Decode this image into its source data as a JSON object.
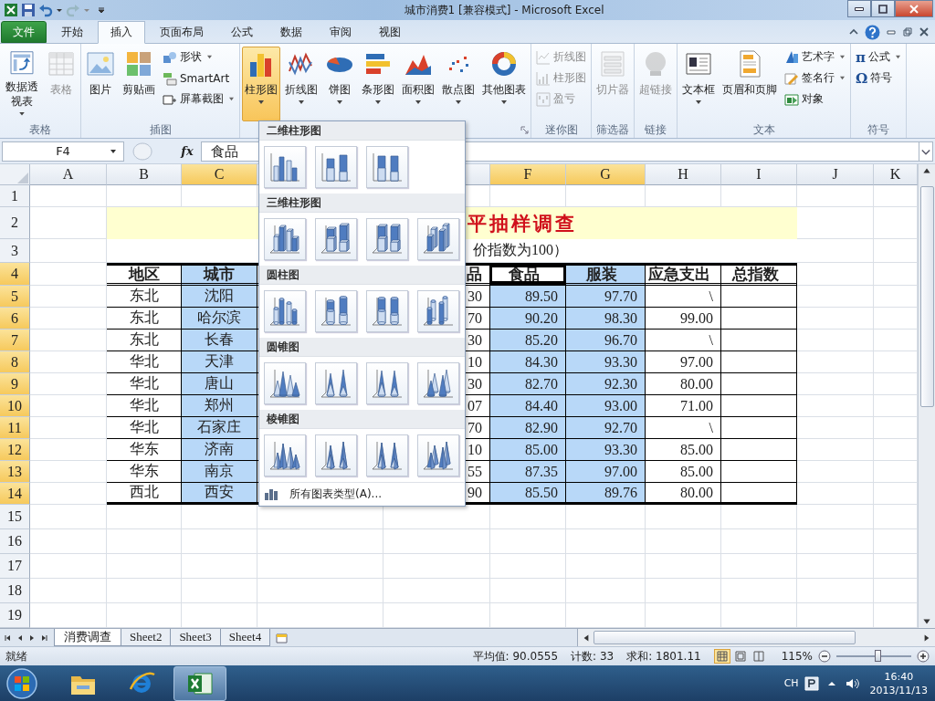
{
  "window": {
    "title": "城市消费1  [兼容模式] - Microsoft Excel"
  },
  "ribbon_tabs": [
    {
      "label": "文件",
      "kind": "file",
      "selected": false
    },
    {
      "label": "开始",
      "kind": "tab",
      "selected": false
    },
    {
      "label": "插入",
      "kind": "tab",
      "selected": true
    },
    {
      "label": "页面布局",
      "kind": "tab",
      "selected": false
    },
    {
      "label": "公式",
      "kind": "tab",
      "selected": false
    },
    {
      "label": "数据",
      "kind": "tab",
      "selected": false
    },
    {
      "label": "审阅",
      "kind": "tab",
      "selected": false
    },
    {
      "label": "视图",
      "kind": "tab",
      "selected": false
    }
  ],
  "ribbon_groups": [
    {
      "label": "表格",
      "launcher": false,
      "items": [
        {
          "kind": "large",
          "label": "数据透视表",
          "dropdown": true,
          "disabled": false,
          "pressed": false
        },
        {
          "kind": "large",
          "label": "表格",
          "dropdown": false,
          "disabled": true,
          "pressed": false
        }
      ]
    },
    {
      "label": "插图",
      "launcher": false,
      "items": [
        {
          "kind": "large",
          "label": "图片",
          "dropdown": false,
          "disabled": false,
          "pressed": false
        },
        {
          "kind": "large",
          "label": "剪贴画",
          "dropdown": false,
          "disabled": false,
          "pressed": false
        },
        {
          "kind": "small",
          "label": "形状",
          "dropdown": true,
          "disabled": false,
          "pressed": false
        },
        {
          "kind": "small",
          "label": "SmartArt",
          "dropdown": false,
          "disabled": false,
          "pressed": false
        },
        {
          "kind": "small",
          "label": "屏幕截图",
          "dropdown": true,
          "disabled": false,
          "pressed": false
        }
      ]
    },
    {
      "launcher": true,
      "items": [
        {
          "kind": "large",
          "label": "柱形图",
          "dropdown": true,
          "disabled": false,
          "pressed": true
        },
        {
          "kind": "large",
          "label": "折线图",
          "dropdown": true,
          "disabled": false,
          "pressed": false
        },
        {
          "kind": "large",
          "label": "饼图",
          "dropdown": true,
          "disabled": false,
          "pressed": false
        },
        {
          "kind": "large",
          "label": "条形图",
          "dropdown": true,
          "disabled": false,
          "pressed": false
        },
        {
          "kind": "large",
          "label": "面积图",
          "dropdown": true,
          "disabled": false,
          "pressed": false
        },
        {
          "kind": "large",
          "label": "散点图",
          "dropdown": true,
          "disabled": false,
          "pressed": false
        },
        {
          "kind": "large",
          "label": "其他图表",
          "dropdown": true,
          "disabled": false,
          "pressed": false
        }
      ]
    },
    {
      "label": "迷你图",
      "launcher": false,
      "items": [
        {
          "kind": "small",
          "label": "折线图",
          "dropdown": false,
          "disabled": true,
          "pressed": false
        },
        {
          "kind": "small",
          "label": "柱形图",
          "dropdown": false,
          "disabled": true,
          "pressed": false
        },
        {
          "kind": "small",
          "label": "盈亏",
          "dropdown": false,
          "disabled": true,
          "pressed": false
        }
      ]
    },
    {
      "label": "筛选器",
      "launcher": false,
      "items": [
        {
          "kind": "large",
          "label": "切片器",
          "dropdown": false,
          "disabled": true,
          "pressed": false
        }
      ]
    },
    {
      "label": "链接",
      "launcher": false,
      "items": [
        {
          "kind": "large",
          "label": "超链接",
          "dropdown": false,
          "disabled": true,
          "pressed": false
        }
      ]
    },
    {
      "label": "文本",
      "launcher": false,
      "items": [
        {
          "kind": "large",
          "label": "文本框",
          "dropdown": true,
          "disabled": false,
          "pressed": false
        },
        {
          "kind": "large",
          "label": "页眉和页脚",
          "dropdown": false,
          "disabled": false,
          "pressed": false
        },
        {
          "kind": "small",
          "label": "艺术字",
          "dropdown": true,
          "disabled": false,
          "pressed": false
        },
        {
          "kind": "small",
          "label": "签名行",
          "dropdown": true,
          "disabled": false,
          "pressed": false
        },
        {
          "kind": "small",
          "label": "对象",
          "dropdown": false,
          "disabled": false,
          "pressed": false
        }
      ]
    },
    {
      "label": "符号",
      "launcher": false,
      "items": [
        {
          "kind": "small",
          "glyph": "π",
          "label": "公式",
          "dropdown": true,
          "disabled": false,
          "pressed": false
        },
        {
          "kind": "small",
          "glyph": "Ω",
          "label": "符号",
          "dropdown": false,
          "disabled": false,
          "pressed": false
        }
      ]
    }
  ],
  "chart_menu": {
    "sections": [
      {
        "title": "二维柱形图",
        "kind": "column",
        "options": [
          {
            "selected": false
          },
          {
            "selected": false
          },
          {
            "selected": false
          }
        ]
      },
      {
        "title": "三维柱形图",
        "kind": "column3d",
        "options": [
          {
            "selected": false
          },
          {
            "selected": false
          },
          {
            "selected": false
          },
          {
            "selected": false
          }
        ]
      },
      {
        "title": "圆柱图",
        "kind": "cylinder",
        "options": [
          {
            "selected": false
          },
          {
            "selected": false
          },
          {
            "selected": false
          },
          {
            "selected": false
          }
        ]
      },
      {
        "title": "圆锥图",
        "kind": "cone",
        "options": [
          {
            "selected": false
          },
          {
            "selected": false
          },
          {
            "selected": false
          },
          {
            "selected": false
          }
        ]
      },
      {
        "title": "棱锥图",
        "kind": "pyramid",
        "options": [
          {
            "selected": false
          },
          {
            "selected": false
          },
          {
            "selected": false
          },
          {
            "selected": false
          }
        ]
      }
    ],
    "footer": "所有图表类型(A)..."
  },
  "formula_bar": {
    "name_box": "F4",
    "function_button": "fx",
    "formula": "食品"
  },
  "sheet": {
    "columns": [
      {
        "label": "A",
        "selected": false
      },
      {
        "label": "B",
        "selected": false
      },
      {
        "label": "C",
        "selected": true
      },
      {
        "label": "F",
        "selected": true
      },
      {
        "label": "G",
        "selected": true
      },
      {
        "label": "H",
        "selected": false
      },
      {
        "label": "I",
        "selected": false
      },
      {
        "label": "J",
        "selected": false
      },
      {
        "label": "K",
        "selected": false
      }
    ],
    "rows": [
      {
        "label": "1",
        "selected": false
      },
      {
        "label": "2",
        "selected": false
      },
      {
        "label": "3",
        "selected": false
      },
      {
        "label": "4",
        "selected": true
      },
      {
        "label": "5",
        "selected": true
      },
      {
        "label": "6",
        "selected": true
      },
      {
        "label": "7",
        "selected": true
      },
      {
        "label": "8",
        "selected": true
      },
      {
        "label": "9",
        "selected": true
      },
      {
        "label": "10",
        "selected": true
      },
      {
        "label": "11",
        "selected": true
      },
      {
        "label": "12",
        "selected": true
      },
      {
        "label": "13",
        "selected": true
      },
      {
        "label": "14",
        "selected": true
      },
      {
        "label": "15",
        "selected": false
      },
      {
        "label": "16",
        "selected": false
      },
      {
        "label": "17",
        "selected": false
      },
      {
        "label": "18",
        "selected": false
      },
      {
        "label": "19",
        "selected": false
      }
    ],
    "title": "平抽样调查",
    "subtitle": "价指数为100）",
    "table": {
      "columns": [
        {
          "label": "地区",
          "active": false
        },
        {
          "label": "城市",
          "active": false
        },
        {
          "label": "品",
          "active": false
        },
        {
          "label": "食品",
          "active": true
        },
        {
          "label": "服装",
          "active": false
        },
        {
          "label": "应急支出",
          "active": false
        },
        {
          "label": "总指数",
          "active": false
        }
      ],
      "rows": [
        [
          "东北",
          "沈阳",
          "30",
          "89.50",
          "97.70",
          "\\"
        ],
        [
          "东北",
          "哈尔滨",
          "70",
          "90.20",
          "98.30",
          "99.00"
        ],
        [
          "东北",
          "长春",
          "30",
          "85.20",
          "96.70",
          "\\"
        ],
        [
          "华北",
          "天津",
          "10",
          "84.30",
          "93.30",
          "97.00"
        ],
        [
          "华北",
          "唐山",
          "30",
          "82.70",
          "92.30",
          "80.00"
        ],
        [
          "华北",
          "郑州",
          "07",
          "84.40",
          "93.00",
          "71.00"
        ],
        [
          "华北",
          "石家庄",
          "70",
          "82.90",
          "92.70",
          "\\"
        ],
        [
          "华东",
          "济南",
          "10",
          "85.00",
          "93.30",
          "85.00"
        ],
        [
          "华东",
          "南京",
          "55",
          "87.35",
          "97.00",
          "85.00"
        ],
        [
          "西北",
          "西安",
          "90",
          "85.50",
          "89.76",
          "80.00"
        ]
      ]
    }
  },
  "sheet_tabs": [
    {
      "label": "消费调查",
      "selected": true
    },
    {
      "label": "Sheet2",
      "selected": false
    },
    {
      "label": "Sheet3",
      "selected": false
    },
    {
      "label": "Sheet4",
      "selected": false
    }
  ],
  "status_bar": {
    "ready": "就绪",
    "average": "平均值: 90.0555",
    "count": "计数: 33",
    "sum": "求和: 1801.11",
    "views": [
      {
        "kind": "normal",
        "selected": true
      },
      {
        "kind": "page_layout",
        "selected": false
      },
      {
        "kind": "page_break",
        "selected": false
      }
    ],
    "zoom": "115%",
    "zoom_slider": {
      "level": 0.55
    }
  },
  "taskbar": {
    "apps": [
      {
        "kind": "explorer",
        "selected": false
      },
      {
        "kind": "browser",
        "selected": false
      },
      {
        "kind": "excel",
        "selected": true
      }
    ],
    "language": "CH",
    "time": "16:40",
    "date": "2013/11/13"
  }
}
